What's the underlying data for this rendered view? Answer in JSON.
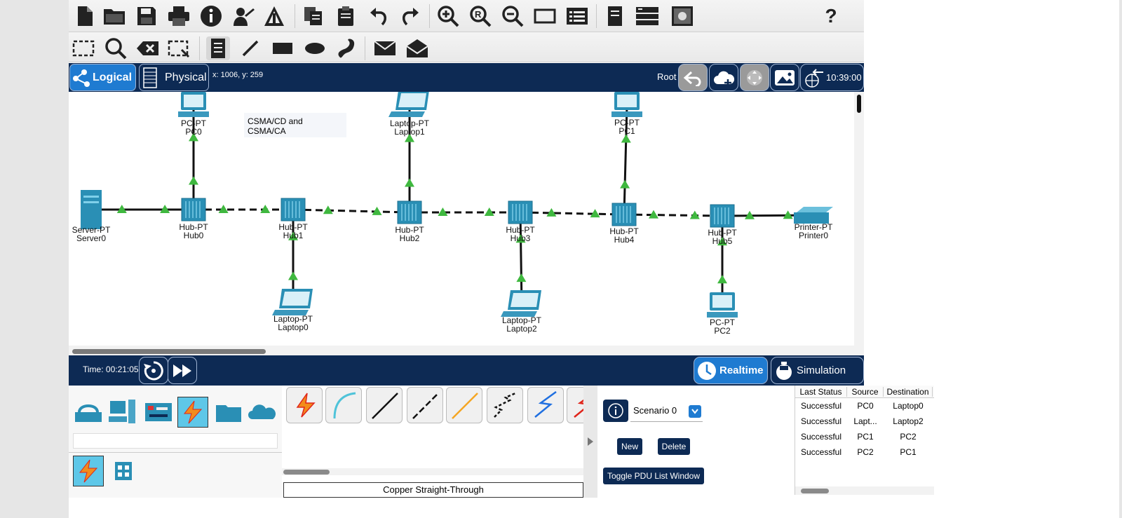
{
  "navbar": {
    "logical_label": "Logical",
    "physical_label": "Physical",
    "coordinates": "x: 1006, y: 259",
    "root_label": "Root",
    "clock": "10:39:00"
  },
  "canvas": {
    "note": "CSMA/CD and CSMA/CA",
    "devices": [
      {
        "type": "PC-PT",
        "name": "PC0"
      },
      {
        "type": "Laptop-PT",
        "name": "Laptop1"
      },
      {
        "type": "PC-PT",
        "name": "PC1"
      },
      {
        "type": "Server-PT",
        "name": "Server0"
      },
      {
        "type": "Hub-PT",
        "name": "Hub0"
      },
      {
        "type": "Hub-PT",
        "name": "Hub1"
      },
      {
        "type": "Hub-PT",
        "name": "Hub2"
      },
      {
        "type": "Hub-PT",
        "name": "Hub3"
      },
      {
        "type": "Hub-PT",
        "name": "Hub4"
      },
      {
        "type": "Hub-PT",
        "name": "Hub5"
      },
      {
        "type": "Printer-PT",
        "name": "Printer0"
      },
      {
        "type": "Laptop-PT",
        "name": "Laptop0"
      },
      {
        "type": "Laptop-PT",
        "name": "Laptop2"
      },
      {
        "type": "PC-PT",
        "name": "PC2"
      }
    ]
  },
  "timebar": {
    "time": "Time: 00:21:05",
    "realtime_label": "Realtime",
    "simulation_label": "Simulation"
  },
  "bottom": {
    "cable_name": "Copper Straight-Through",
    "scenario": "Scenario 0",
    "new_label": "New",
    "delete_label": "Delete",
    "toggle_label": "Toggle PDU List Window",
    "pdu_headers": [
      "Last Status",
      "Source",
      "Destination"
    ],
    "pdu_rows": [
      [
        "Successful",
        "PC0",
        "Laptop0"
      ],
      [
        "Successful",
        "Lapt...",
        "Laptop2"
      ],
      [
        "Successful",
        "PC1",
        "PC2"
      ],
      [
        "Successful",
        "PC2",
        "PC1"
      ]
    ]
  },
  "help_label": "?",
  "colors": {
    "navy": "#0d2a54",
    "arrow": "#3fb83f",
    "device": "#2a8fb5",
    "accent_blue": "#1f7bd1"
  }
}
